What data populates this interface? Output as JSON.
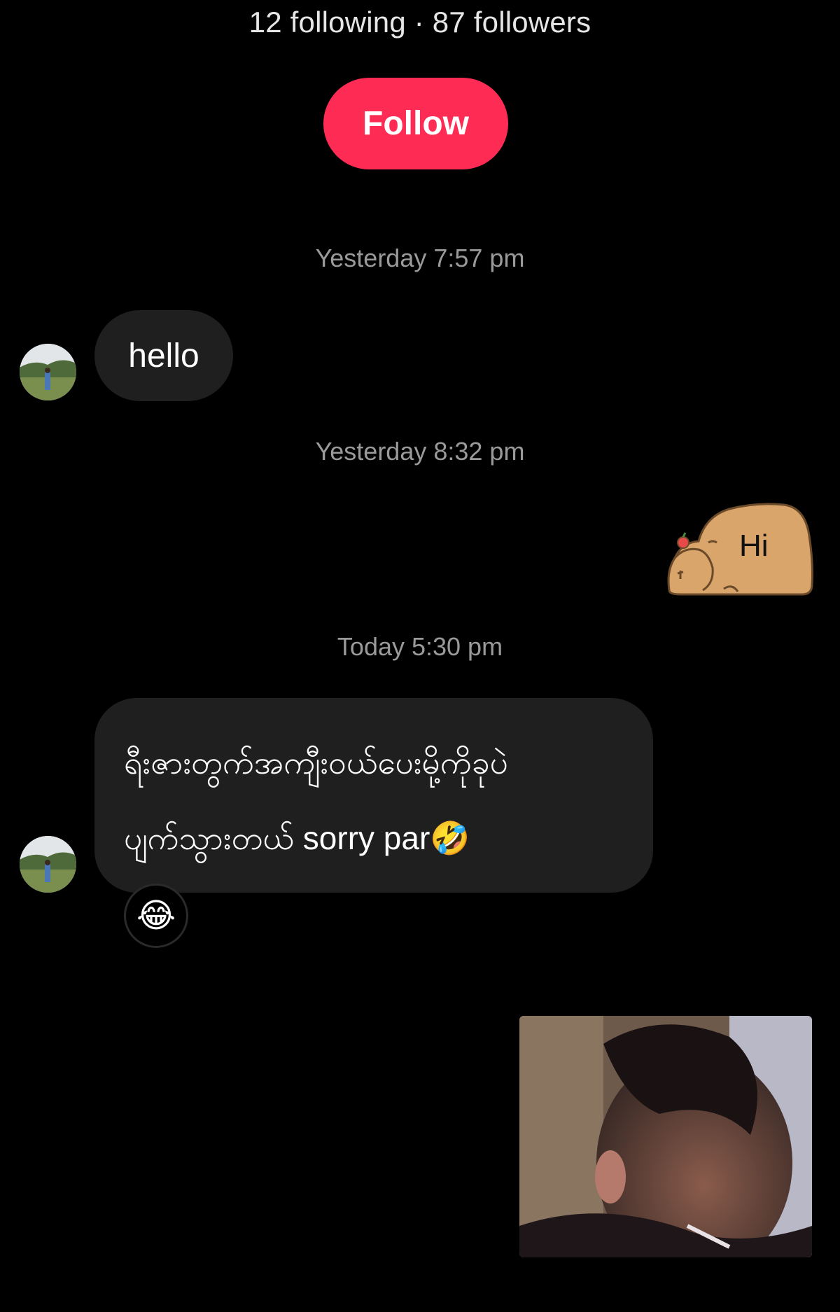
{
  "profile": {
    "stats_text": "12 following · 87 followers",
    "follow_label": "Follow"
  },
  "colors": {
    "follow_button": "#fe2c55",
    "incoming_bubble": "#1f1f1f",
    "background": "#000000",
    "timestamp": "#9a9a9a"
  },
  "messages": [
    {
      "timestamp": "Yesterday 7:57 pm",
      "sender": "other",
      "type": "text",
      "text": "hello"
    },
    {
      "timestamp": "Yesterday 8:32 pm",
      "sender": "me",
      "type": "sticker",
      "sticker_text": "Hi",
      "sticker_icon": "capybara-sticker"
    },
    {
      "timestamp": "Today 5:30 pm",
      "sender": "other",
      "type": "text",
      "text_line1": "ရီးဇားတွက်အကျီးဝယ်ပေးမို့ကိုခုပဲ",
      "text_line2": "ပျက်သွားတယ် sorry par🤣",
      "reaction": "😂"
    },
    {
      "sender": "me",
      "type": "image",
      "image_icon": "photo-thumbnail"
    }
  ]
}
